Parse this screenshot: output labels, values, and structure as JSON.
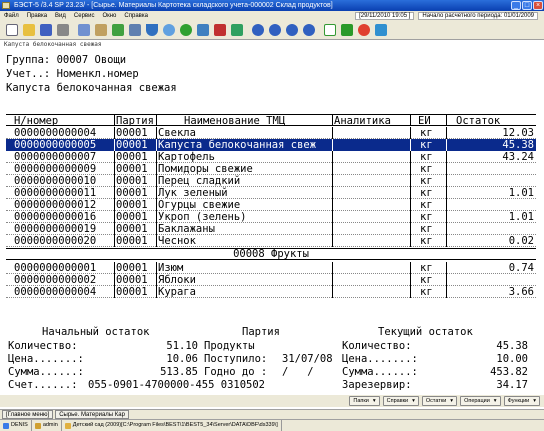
{
  "window": {
    "title": "БЭСТ-5 /3.4 SP 23.23/ - [Сырье. Материалы Картотека складского учета-000002  Склад продуктов]"
  },
  "menu": {
    "items": [
      "Файл",
      "Правка",
      "Вид",
      "Сервис",
      "Окно",
      "Справка"
    ],
    "datetime": "[29/11/2010 19:05 ]",
    "period": "Начало расчетного периода: 01/01/2009"
  },
  "toolbar": {
    "icons": [
      "new-doc-icon",
      "open-icon",
      "save-icon",
      "print-icon",
      "copy-icon",
      "paste-icon",
      "cut-icon",
      "calc-icon",
      "filter-icon",
      "find-icon",
      "refresh-icon",
      "sort-icon",
      "delete-filter-icon",
      "tree-icon",
      "go-first-icon",
      "go-prev-icon",
      "go-next-icon",
      "go-last-icon",
      "checkbox-icon",
      "export-icon",
      "cancel-icon",
      "exit-icon"
    ]
  },
  "doc": {
    "caption": "Капуста белокочанная свежая",
    "group_line": "Группа: 00007 Овощи",
    "account_line": "Учет..: Номенкл.номер",
    "item_name": "Капуста белокочанная свежая"
  },
  "grid": {
    "headers": [
      "Н/номер",
      "Партия",
      "Наименование ТМЦ",
      "Аналитика",
      "ЕИ",
      "Остаток"
    ],
    "rows": [
      {
        "num": "0000000000004",
        "party": "00001",
        "name": "Свекла",
        "unit": "кг",
        "rest": "12.03"
      },
      {
        "num": "0000000000005",
        "party": "00001",
        "name": "Капуста белокочанная свеж",
        "unit": "кг",
        "rest": "45.38"
      },
      {
        "num": "0000000000007",
        "party": "00001",
        "name": "Картофель",
        "unit": "кг",
        "rest": "43.24"
      },
      {
        "num": "0000000000009",
        "party": "00001",
        "name": "Помидоры свежие",
        "unit": "кг",
        "rest": ""
      },
      {
        "num": "0000000000010",
        "party": "00001",
        "name": "Перец сладкий",
        "unit": "кг",
        "rest": ""
      },
      {
        "num": "0000000000011",
        "party": "00001",
        "name": "Лук зеленый",
        "unit": "кг",
        "rest": "1.01"
      },
      {
        "num": "0000000000012",
        "party": "00001",
        "name": "Огурцы свежие",
        "unit": "кг",
        "rest": ""
      },
      {
        "num": "0000000000016",
        "party": "00001",
        "name": "Укроп (зелень)",
        "unit": "кг",
        "rest": "1.01"
      },
      {
        "num": "0000000000019",
        "party": "00001",
        "name": "Баклажаны",
        "unit": "кг",
        "rest": ""
      },
      {
        "num": "0000000000020",
        "party": "00001",
        "name": "Чеснок",
        "unit": "кг",
        "rest": "0.02"
      }
    ],
    "group2_title": "00008 Фрукты",
    "rows2": [
      {
        "num": "0000000000001",
        "party": "00001",
        "name": "Изюм",
        "unit": "кг",
        "rest": "0.74"
      },
      {
        "num": "0000000000002",
        "party": "00001",
        "name": "Яблоки",
        "unit": "кг",
        "rest": ""
      },
      {
        "num": "0000000000004",
        "party": "00001",
        "name": "Курага",
        "unit": "кг",
        "rest": "3.66"
      }
    ]
  },
  "summary": {
    "initial_title": "Начальный остаток",
    "party_title": "Партия",
    "current_title": "Текущий остаток",
    "qty_label": "Количество:",
    "qty_value": "51.10",
    "price_label": "Цена.......:",
    "price_value": "10.06",
    "sum_label": "Сумма......:",
    "sum_value": "513.85",
    "account_label": "Счет......:",
    "account_value": "055-0901-4700000-455 0310502",
    "party_name": "Продукты",
    "received_label": "Поступило:",
    "received_value": "31/07/08",
    "valid_label": "Годно до :",
    "valid_value": "/   /",
    "cur_qty_label": "Количество:",
    "cur_qty_value": "45.38",
    "cur_price_label": "Цена.......:",
    "cur_price_value": "10.00",
    "cur_sum_label": "Сумма......:",
    "cur_sum_value": "453.82",
    "reserved_label": "Зарезервир:",
    "reserved_value": "34.17"
  },
  "buttons": [
    "Папки",
    "Справки",
    "Остатки",
    "Операции",
    "Функции"
  ],
  "tabs": [
    "[Главное меню]",
    "Сырье. Материалы Кар"
  ],
  "status": {
    "user": "DENIS",
    "role": "admin",
    "org": "Детский сад (2009)[C:\\Program Files\\BEST\\1\\BEST5_34\\Server\\DATA\\DBF\\ds339\\]"
  },
  "colors": {
    "selection": "#0a2a8c",
    "titlebar": "#0a3fb0"
  }
}
